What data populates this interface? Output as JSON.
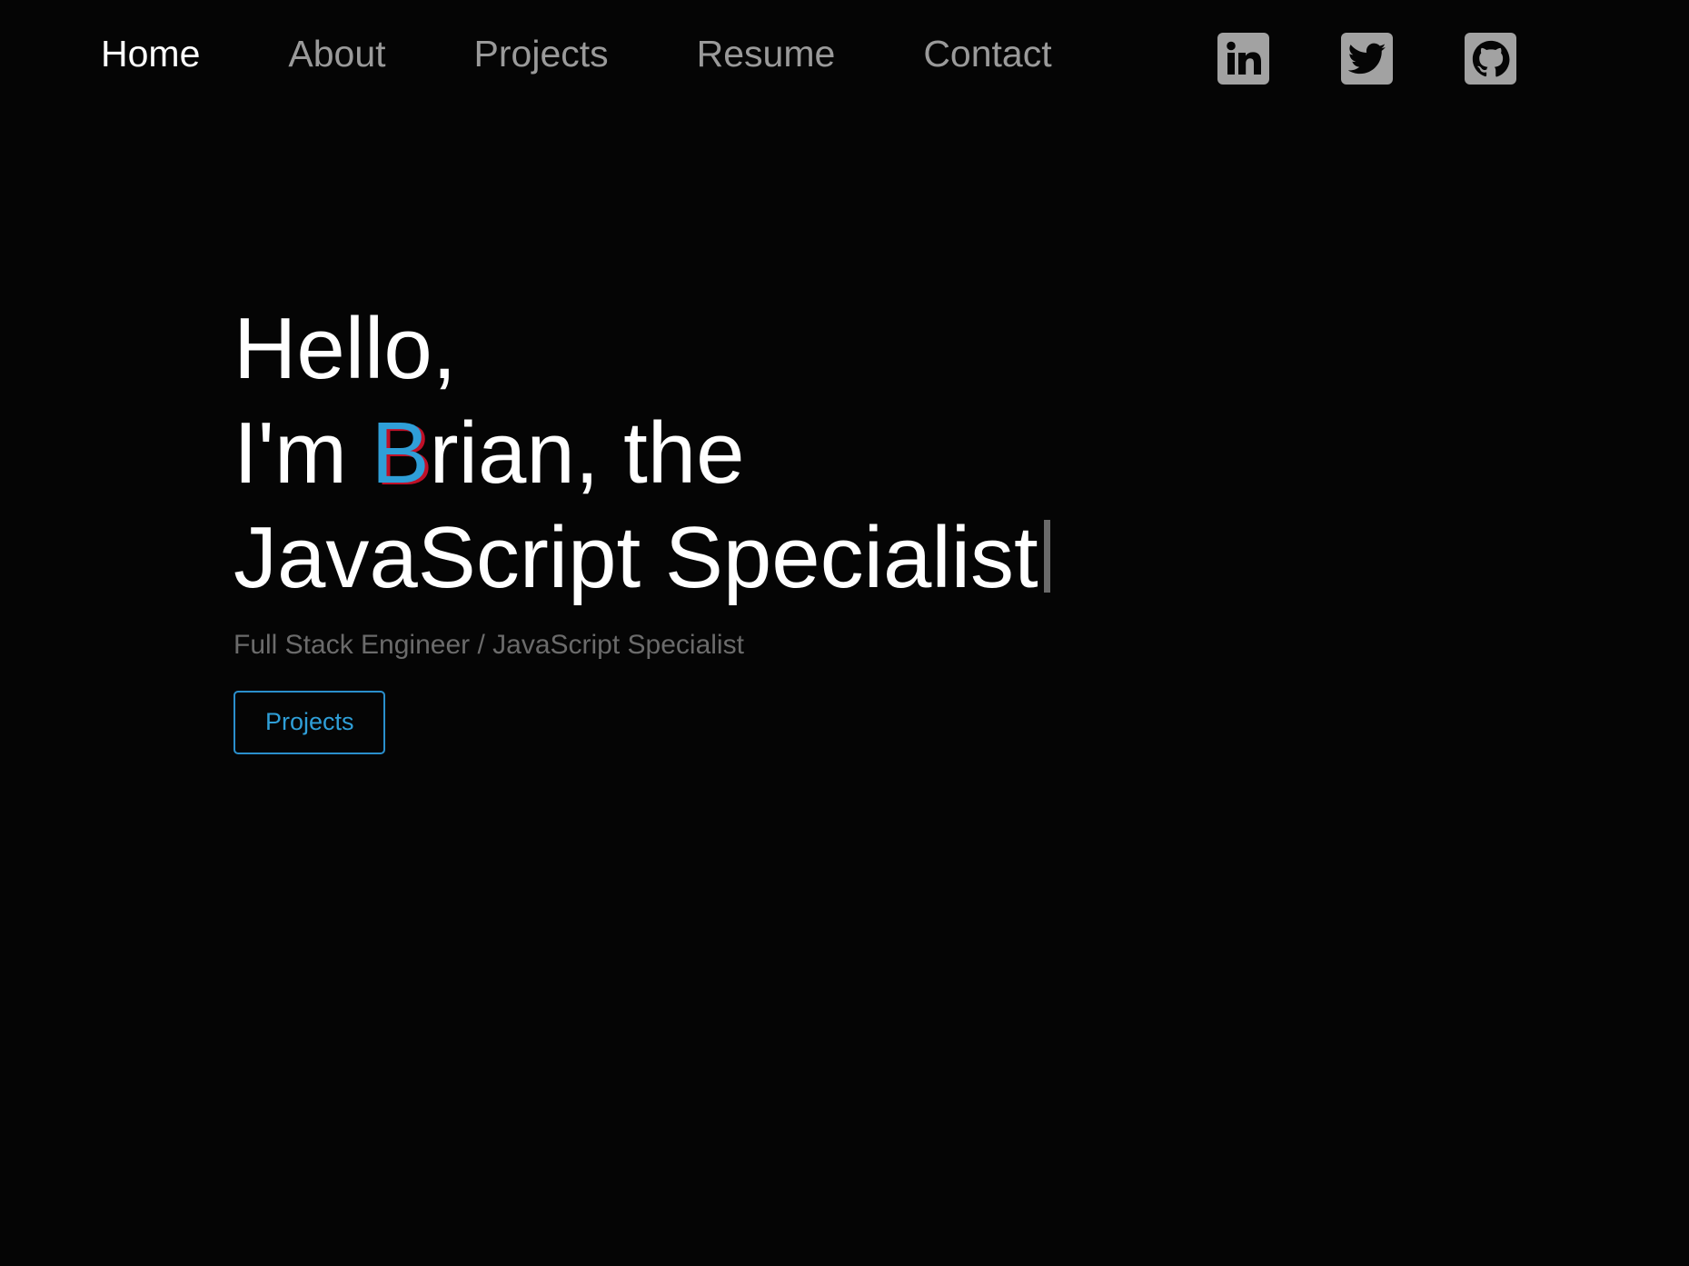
{
  "nav": {
    "links": [
      {
        "label": "Home",
        "active": true
      },
      {
        "label": "About",
        "active": false
      },
      {
        "label": "Projects",
        "active": false
      },
      {
        "label": "Resume",
        "active": false
      },
      {
        "label": "Contact",
        "active": false
      }
    ],
    "social": [
      {
        "icon": "linkedin-icon"
      },
      {
        "icon": "twitter-icon"
      },
      {
        "icon": "github-icon"
      }
    ]
  },
  "hero": {
    "line1": "Hello,",
    "line2_prefix": "I'm ",
    "accent_letter": "B",
    "line2_suffix": "rian, the",
    "line3": "JavaScript Specialist",
    "subtitle": "Full Stack Engineer / JavaScript Specialist",
    "cta_label": "Projects"
  },
  "colors": {
    "background": "#050505",
    "accent": "#2f9fd8",
    "accent_shadow": "#c01028",
    "nav_inactive": "#9a9a9a",
    "subtitle": "#6b6b6b"
  }
}
